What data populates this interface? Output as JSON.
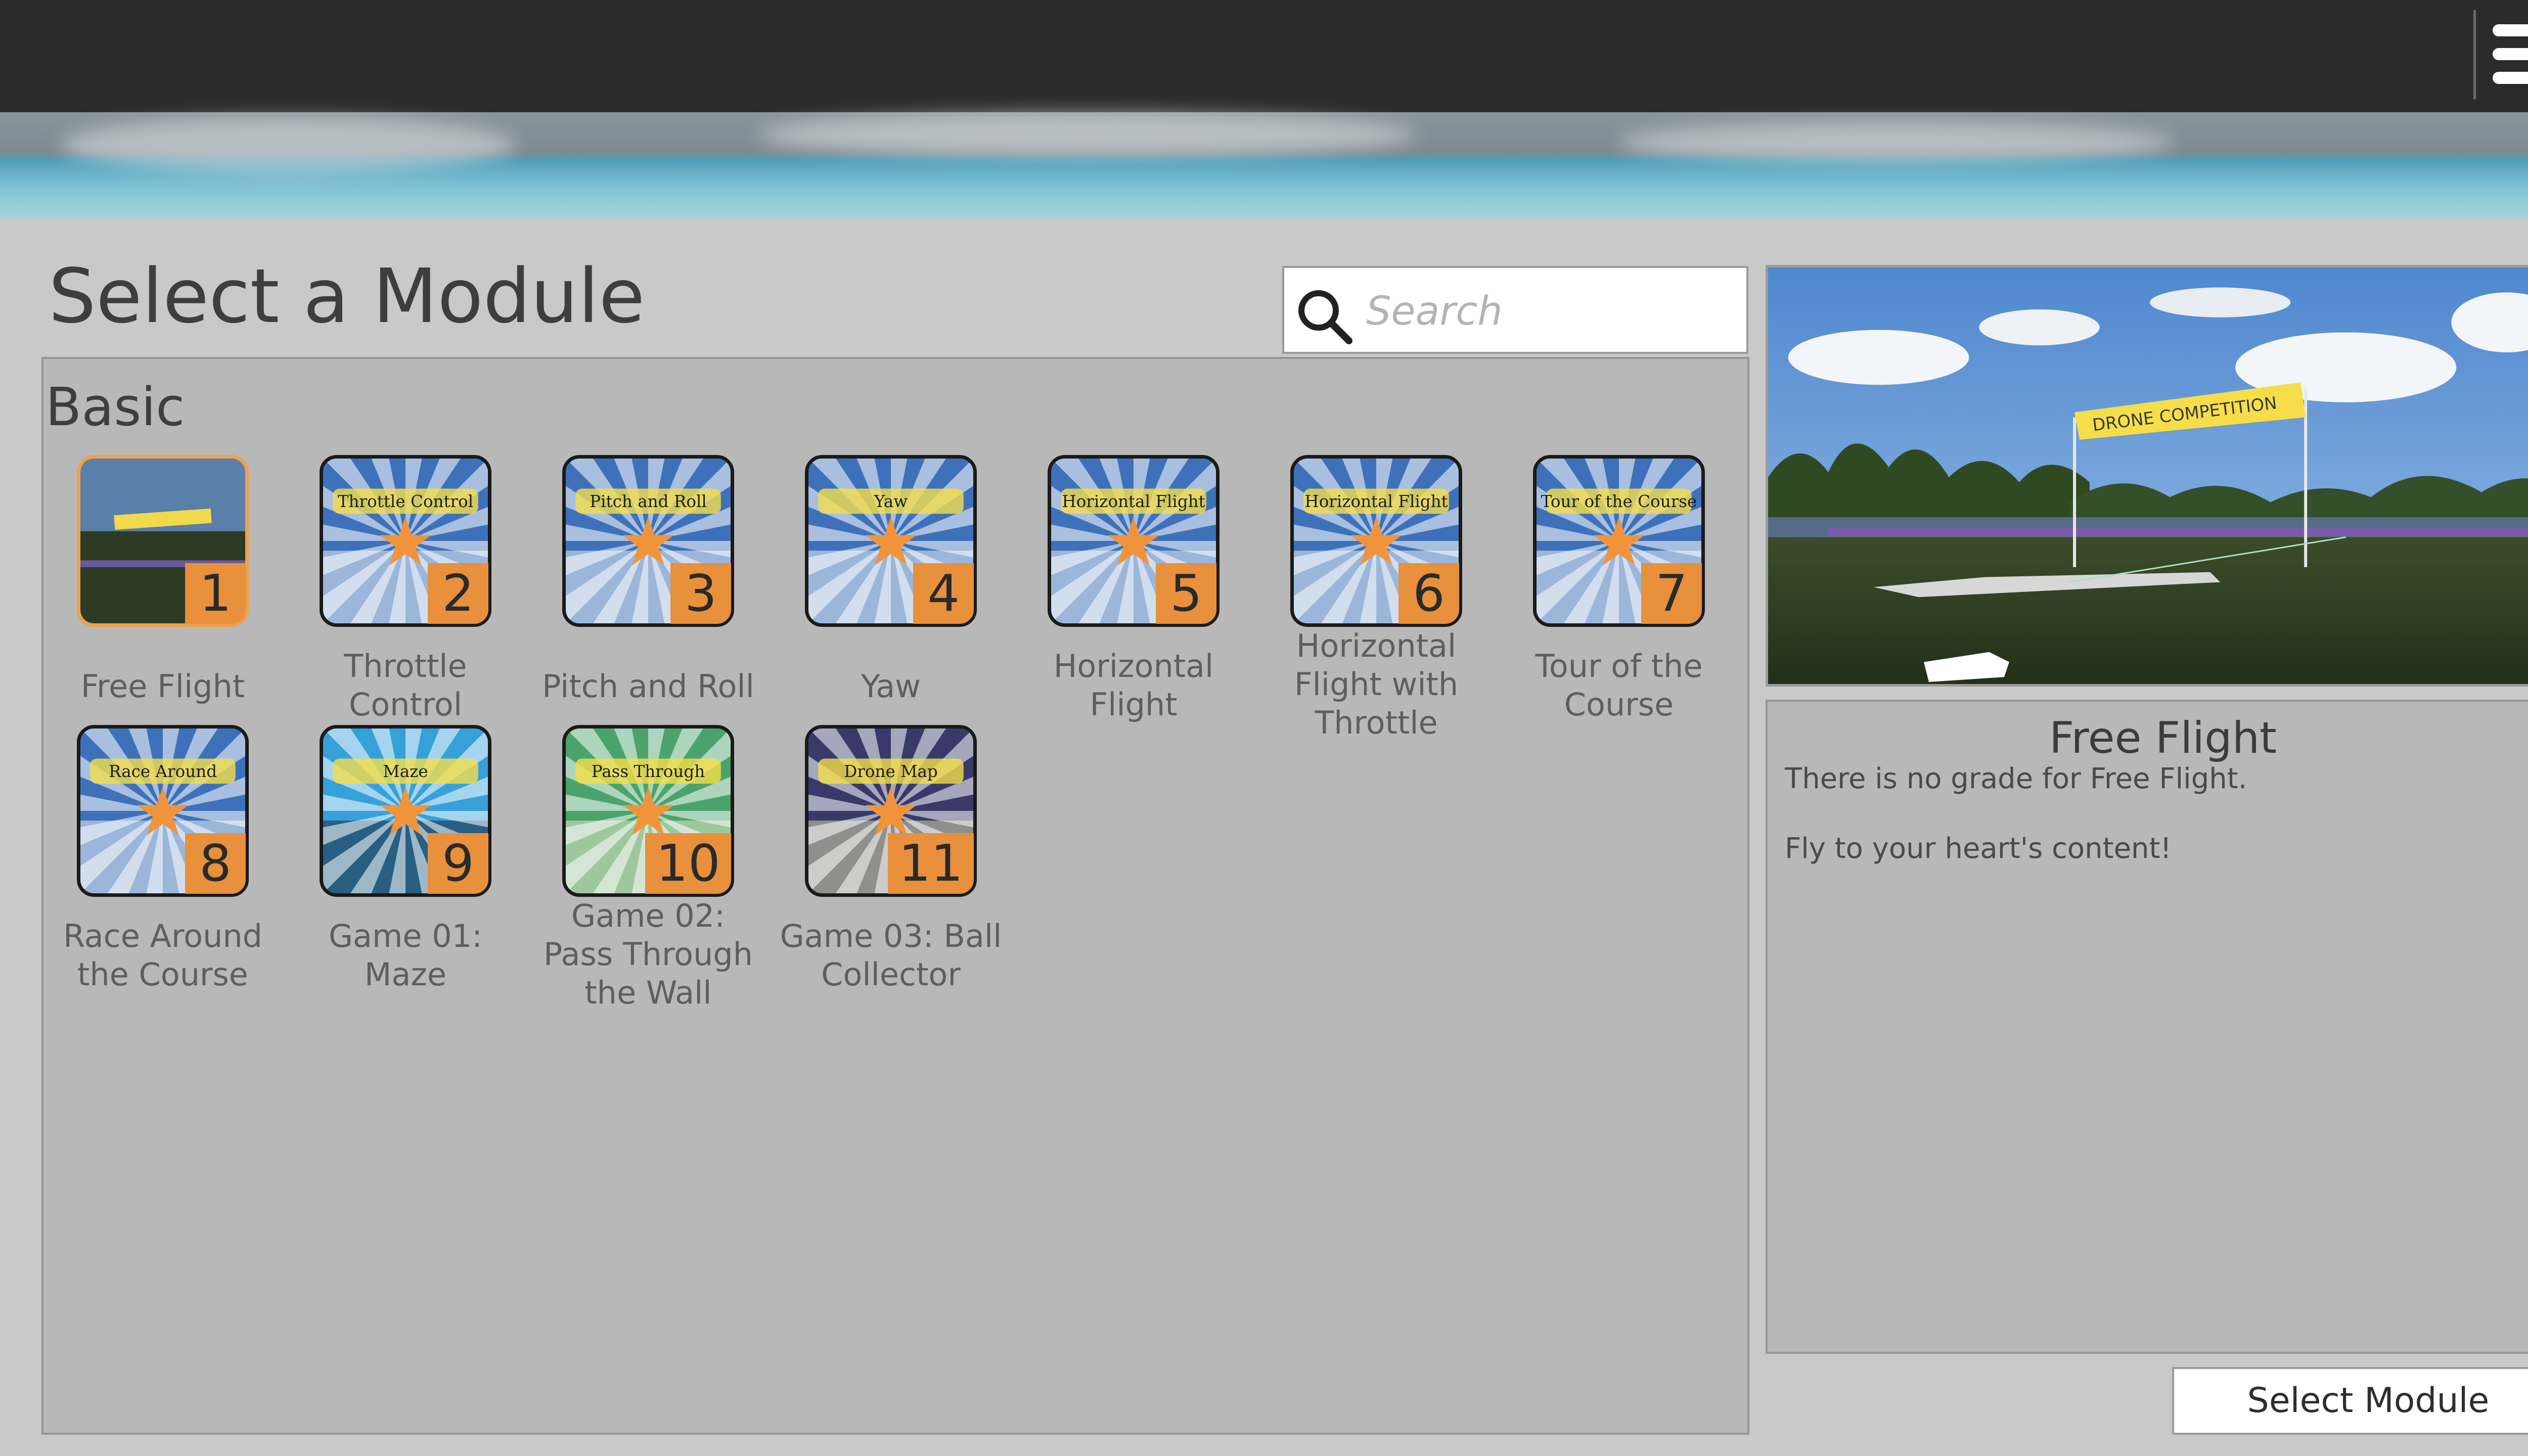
{
  "header": {
    "menu_icon": "hamburger-menu-icon"
  },
  "page": {
    "title": "Select a Module"
  },
  "search": {
    "placeholder": "Search",
    "icon": "search-icon"
  },
  "section": {
    "label": "Basic"
  },
  "modules": [
    {
      "number": "1",
      "name": "Free Flight",
      "banner": "",
      "selected": true
    },
    {
      "number": "2",
      "name": "Throttle Control",
      "banner": "Throttle Control"
    },
    {
      "number": "3",
      "name": "Pitch and Roll",
      "banner": "Pitch and Roll"
    },
    {
      "number": "4",
      "name": "Yaw",
      "banner": "Yaw"
    },
    {
      "number": "5",
      "name": "Horizontal Flight",
      "banner": "Horizontal Flight"
    },
    {
      "number": "6",
      "name": "Horizontal Flight with Throttle",
      "banner": "Horizontal Flight"
    },
    {
      "number": "7",
      "name": "Tour of the Course",
      "banner": "Tour of the Course"
    },
    {
      "number": "8",
      "name": "Race Around the Course",
      "banner": "Race Around"
    },
    {
      "number": "9",
      "name": "Game 01: Maze",
      "banner": "Maze"
    },
    {
      "number": "10",
      "name": "Game 02: Pass Through the Wall",
      "banner": "Pass Through"
    },
    {
      "number": "11",
      "name": "Game 03: Ball Collector",
      "banner": "Drone Map"
    }
  ],
  "preview": {
    "banner_text": "DRONE COMPETITION"
  },
  "details": {
    "title": "Free Flight",
    "line1": "There is no grade for Free Flight.",
    "line2": "Fly to your heart's content!"
  },
  "actions": {
    "select_label": "Select Module"
  },
  "colors": {
    "accent": "#e8903c",
    "topbar": "#2b2b2b",
    "panel": "#b8b8b8"
  }
}
